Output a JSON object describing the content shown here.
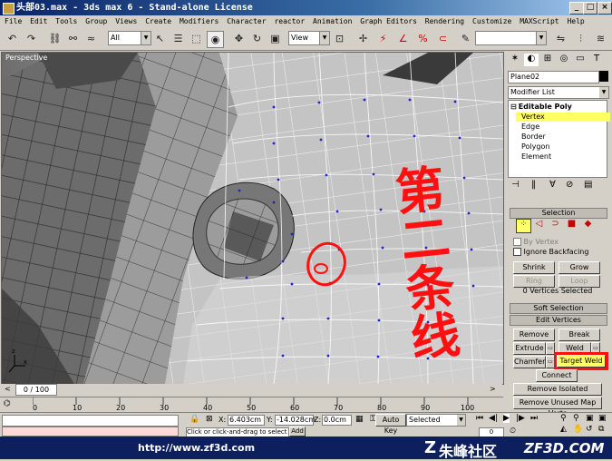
{
  "window": {
    "title": "头部03.max - 3ds max 6 - Stand-alone License"
  },
  "menu": [
    "File",
    "Edit",
    "Tools",
    "Group",
    "Views",
    "Create",
    "Modifiers",
    "Character",
    "reactor",
    "Animation",
    "Graph Editors",
    "Rendering",
    "Customize",
    "MAXScript",
    "Help"
  ],
  "toolbar": {
    "selection_filter": "All",
    "reference_coord": "View"
  },
  "viewport": {
    "label": "Perspective",
    "annotation_text": "第二条线"
  },
  "command_panel": {
    "object_name": "Plane02",
    "modifier_list_label": "Modifier List",
    "stack": {
      "modifier": "Editable Poly",
      "subobjects": [
        "Vertex",
        "Edge",
        "Border",
        "Polygon",
        "Element"
      ],
      "selected_subobject": "Vertex"
    },
    "selection": {
      "title": "Selection",
      "by_vertex": "By Vertex",
      "ignore_backfacing": "Ignore Backfacing",
      "shrink": "Shrink",
      "grow": "Grow",
      "ring": "Ring",
      "loop": "Loop",
      "status": "0 Vertices Selected"
    },
    "soft_selection_title": "Soft Selection",
    "edit_vertices": {
      "title": "Edit Vertices",
      "remove": "Remove",
      "break": "Break",
      "extrude": "Extrude",
      "weld": "Weld",
      "chamfer": "Chamfer",
      "target_weld": "Target Weld",
      "connect": "Connect",
      "remove_isolated": "Remove Isolated Vertices",
      "remove_unused_map": "Remove Unused Map Verts"
    }
  },
  "timeline": {
    "frame_display": "0 / 100",
    "ruler_ticks": [
      "0",
      "10",
      "20",
      "30",
      "40",
      "50",
      "60",
      "70",
      "80",
      "90",
      "100"
    ]
  },
  "status": {
    "x_label": "X:",
    "x_value": "6.403cm",
    "y_label": "Y:",
    "y_value": "-14.028cm",
    "z_label": "Z:",
    "z_value": "0.0cm",
    "auto_key": "Auto Key",
    "key_filter": "Selected",
    "frame_field": "0",
    "prompt": "Click or click-and-drag to select ob",
    "add_btn": "Add"
  },
  "footer": {
    "url": "http://www.zf3d.com",
    "brand_cn": "朱峰社区",
    "brand_en": "ZF3D.COM"
  },
  "colors": {
    "title_bg": "#0a246a",
    "stack_highlight": "#ffff66",
    "annotation_red": "#ff1010",
    "footer_bg": "#0d1f5c"
  }
}
